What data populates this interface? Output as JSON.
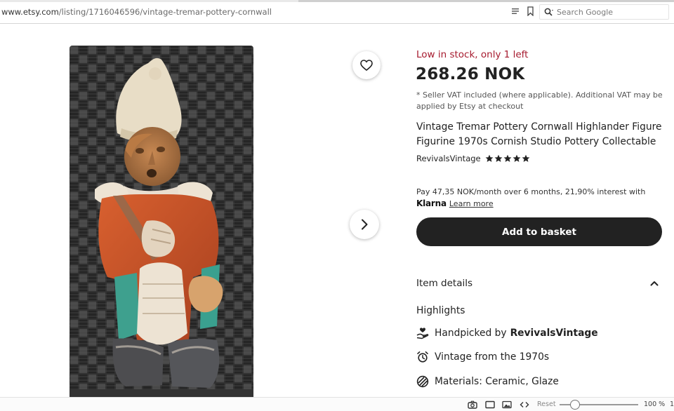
{
  "browser": {
    "url_prefix": "www.etsy.com",
    "url_path": "/listing/1716046596/vintage-tremar-pottery-cornwall",
    "search_placeholder": "Search Google"
  },
  "listing": {
    "stock_notice": "Low in stock, only 1 left",
    "price": "268.26 NOK",
    "vat_note": "* Seller VAT included (where applicable). Additional VAT may be applied by Etsy at checkout",
    "title": "Vintage Tremar Pottery Cornwall Highlander Figure Figurine 1970s Cornish Studio Pottery Collectable",
    "shop_name": "RevivalsVintage",
    "rating_stars": 5,
    "star_color": "#222222",
    "klarna_text": "Pay 47,35 NOK/month over 6 months, 21,90% interest with",
    "klarna_logo": "Klarna",
    "klarna_link": "Learn more",
    "basket_button": "Add to basket",
    "accent_stock_color": "#a61a2e"
  },
  "details": {
    "section_label": "Item details",
    "highlights_label": "Highlights",
    "items": [
      {
        "icon": "hand-heart-icon",
        "text": "Handpicked by",
        "bold": "RevivalsVintage"
      },
      {
        "icon": "alarm-clock-icon",
        "text": "Vintage from the 1970s",
        "bold": ""
      },
      {
        "icon": "layers-icon",
        "text": "Materials: Ceramic, Glaze",
        "bold": ""
      }
    ]
  },
  "statusbar": {
    "reset_label": "Reset",
    "zoom_value": "100 %",
    "zoom_extra": "1"
  }
}
